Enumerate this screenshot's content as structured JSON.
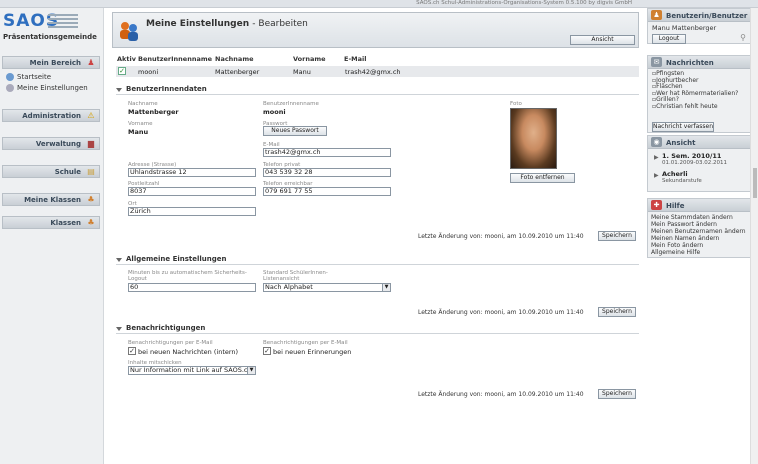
{
  "topbar": {
    "text": "SAOS.ch Schul-Administrations-Organisations-System 0.5.100 by digvis GmbH"
  },
  "app": {
    "logo": "SAOS",
    "org": "Präsentationsgemeinde"
  },
  "sidebar": {
    "mein_bereich": "Mein Bereich",
    "items": [
      {
        "label": "Startseite"
      },
      {
        "label": "Meine Einstellungen"
      }
    ],
    "administration": "Administration",
    "verwaltung": "Verwaltung",
    "schule": "Schule",
    "meine_klassen": "Meine Klassen",
    "klassen": "Klassen"
  },
  "page": {
    "title": "Meine Einstellungen",
    "subtitle": "- Bearbeiten",
    "view_button": "Ansicht"
  },
  "table": {
    "headers": [
      "Aktiv",
      "BenutzerInnenname",
      "Nachname",
      "Vorname",
      "E-Mail"
    ],
    "row": {
      "benutzername": "mooni",
      "nachname": "Mattenberger",
      "vorname": "Manu",
      "email": "trash42@gmx.ch"
    }
  },
  "benutzerdaten": {
    "title": "BenutzerInnendaten",
    "nachname_label": "Nachname",
    "nachname": "Mattenberger",
    "benutzername_label": "BenutzerInnenname",
    "benutzername": "mooni",
    "foto_label": "Foto",
    "vorname_label": "Vorname",
    "vorname": "Manu",
    "passwort_label": "Passwort",
    "passwort_button": "Neues Passwort",
    "email_label": "E-Mail",
    "email": "trash42@gmx.ch",
    "adresse_label": "Adresse (Strasse)",
    "adresse": "Uhlandstrasse 12",
    "tel_privat_label": "Telefon privat",
    "tel_privat": "043 539 32 28",
    "plz_label": "Postleitzahl",
    "plz": "8037",
    "tel_erreichbar_label": "Telefon erreichbar",
    "tel_erreichbar": "079 691 77 55",
    "ort_label": "Ort",
    "ort": "Zürich",
    "foto_button": "Foto entfernen",
    "last_change": "Letzte Änderung von: mooni, am 10.09.2010 um 11:40",
    "save": "Speichern"
  },
  "allgemein": {
    "title": "Allgemeine Einstellungen",
    "logout_label": "Minuten bis zu automatischem Sicherheits-Logout",
    "logout_value": "60",
    "sort_label": "Standard SchülerInnen-Listenansicht",
    "sort_value": "Nach Alphabet",
    "last_change": "Letzte Änderung von: mooni, am 10.09.2010 um 11:40",
    "save": "Speichern"
  },
  "benachrichtigungen": {
    "title": "Benachrichtigungen",
    "n1_label": "Benachrichtigungen per E-Mail",
    "n1_check": "bei neuen Nachrichten (intern)",
    "n2_label": "Benachrichtigungen per E-Mail",
    "n2_check": "bei neuen Erinnerungen",
    "inhalte_label": "Inhalte mitschicken",
    "inhalte_value": "Nur Information mit Link auf SAOS.ch",
    "last_change": "Letzte Änderung von: mooni, am 10.09.2010 um 11:40",
    "save": "Speichern"
  },
  "right": {
    "user": {
      "title": "Benutzerin/Benutzer",
      "name": "Manu Mattenberger",
      "logout": "Logout"
    },
    "nachrichten": {
      "title": "Nachrichten",
      "items": [
        "Pfingsten",
        "Joghurtbecher",
        "Flaschen",
        "Wer hat Römermaterialien?",
        "Grillen?",
        "Christian fehlt heute"
      ],
      "button": "Nachricht verfassen"
    },
    "ansicht": {
      "title": "Ansicht",
      "semester": "1. Sem. 2010/11",
      "semester_dates": "01.01.2009-03.02.2011",
      "ort": "Acherli",
      "stufe": "Sekundarstufe"
    },
    "hilfe": {
      "title": "Hilfe",
      "items": [
        "Meine Stammdaten ändern",
        "Mein Passwort ändern",
        "Meinen Benutzernamen ändern",
        "Meinen Namen ändern",
        "Mein Foto ändern",
        "Allgemeine Hilfe"
      ]
    }
  }
}
